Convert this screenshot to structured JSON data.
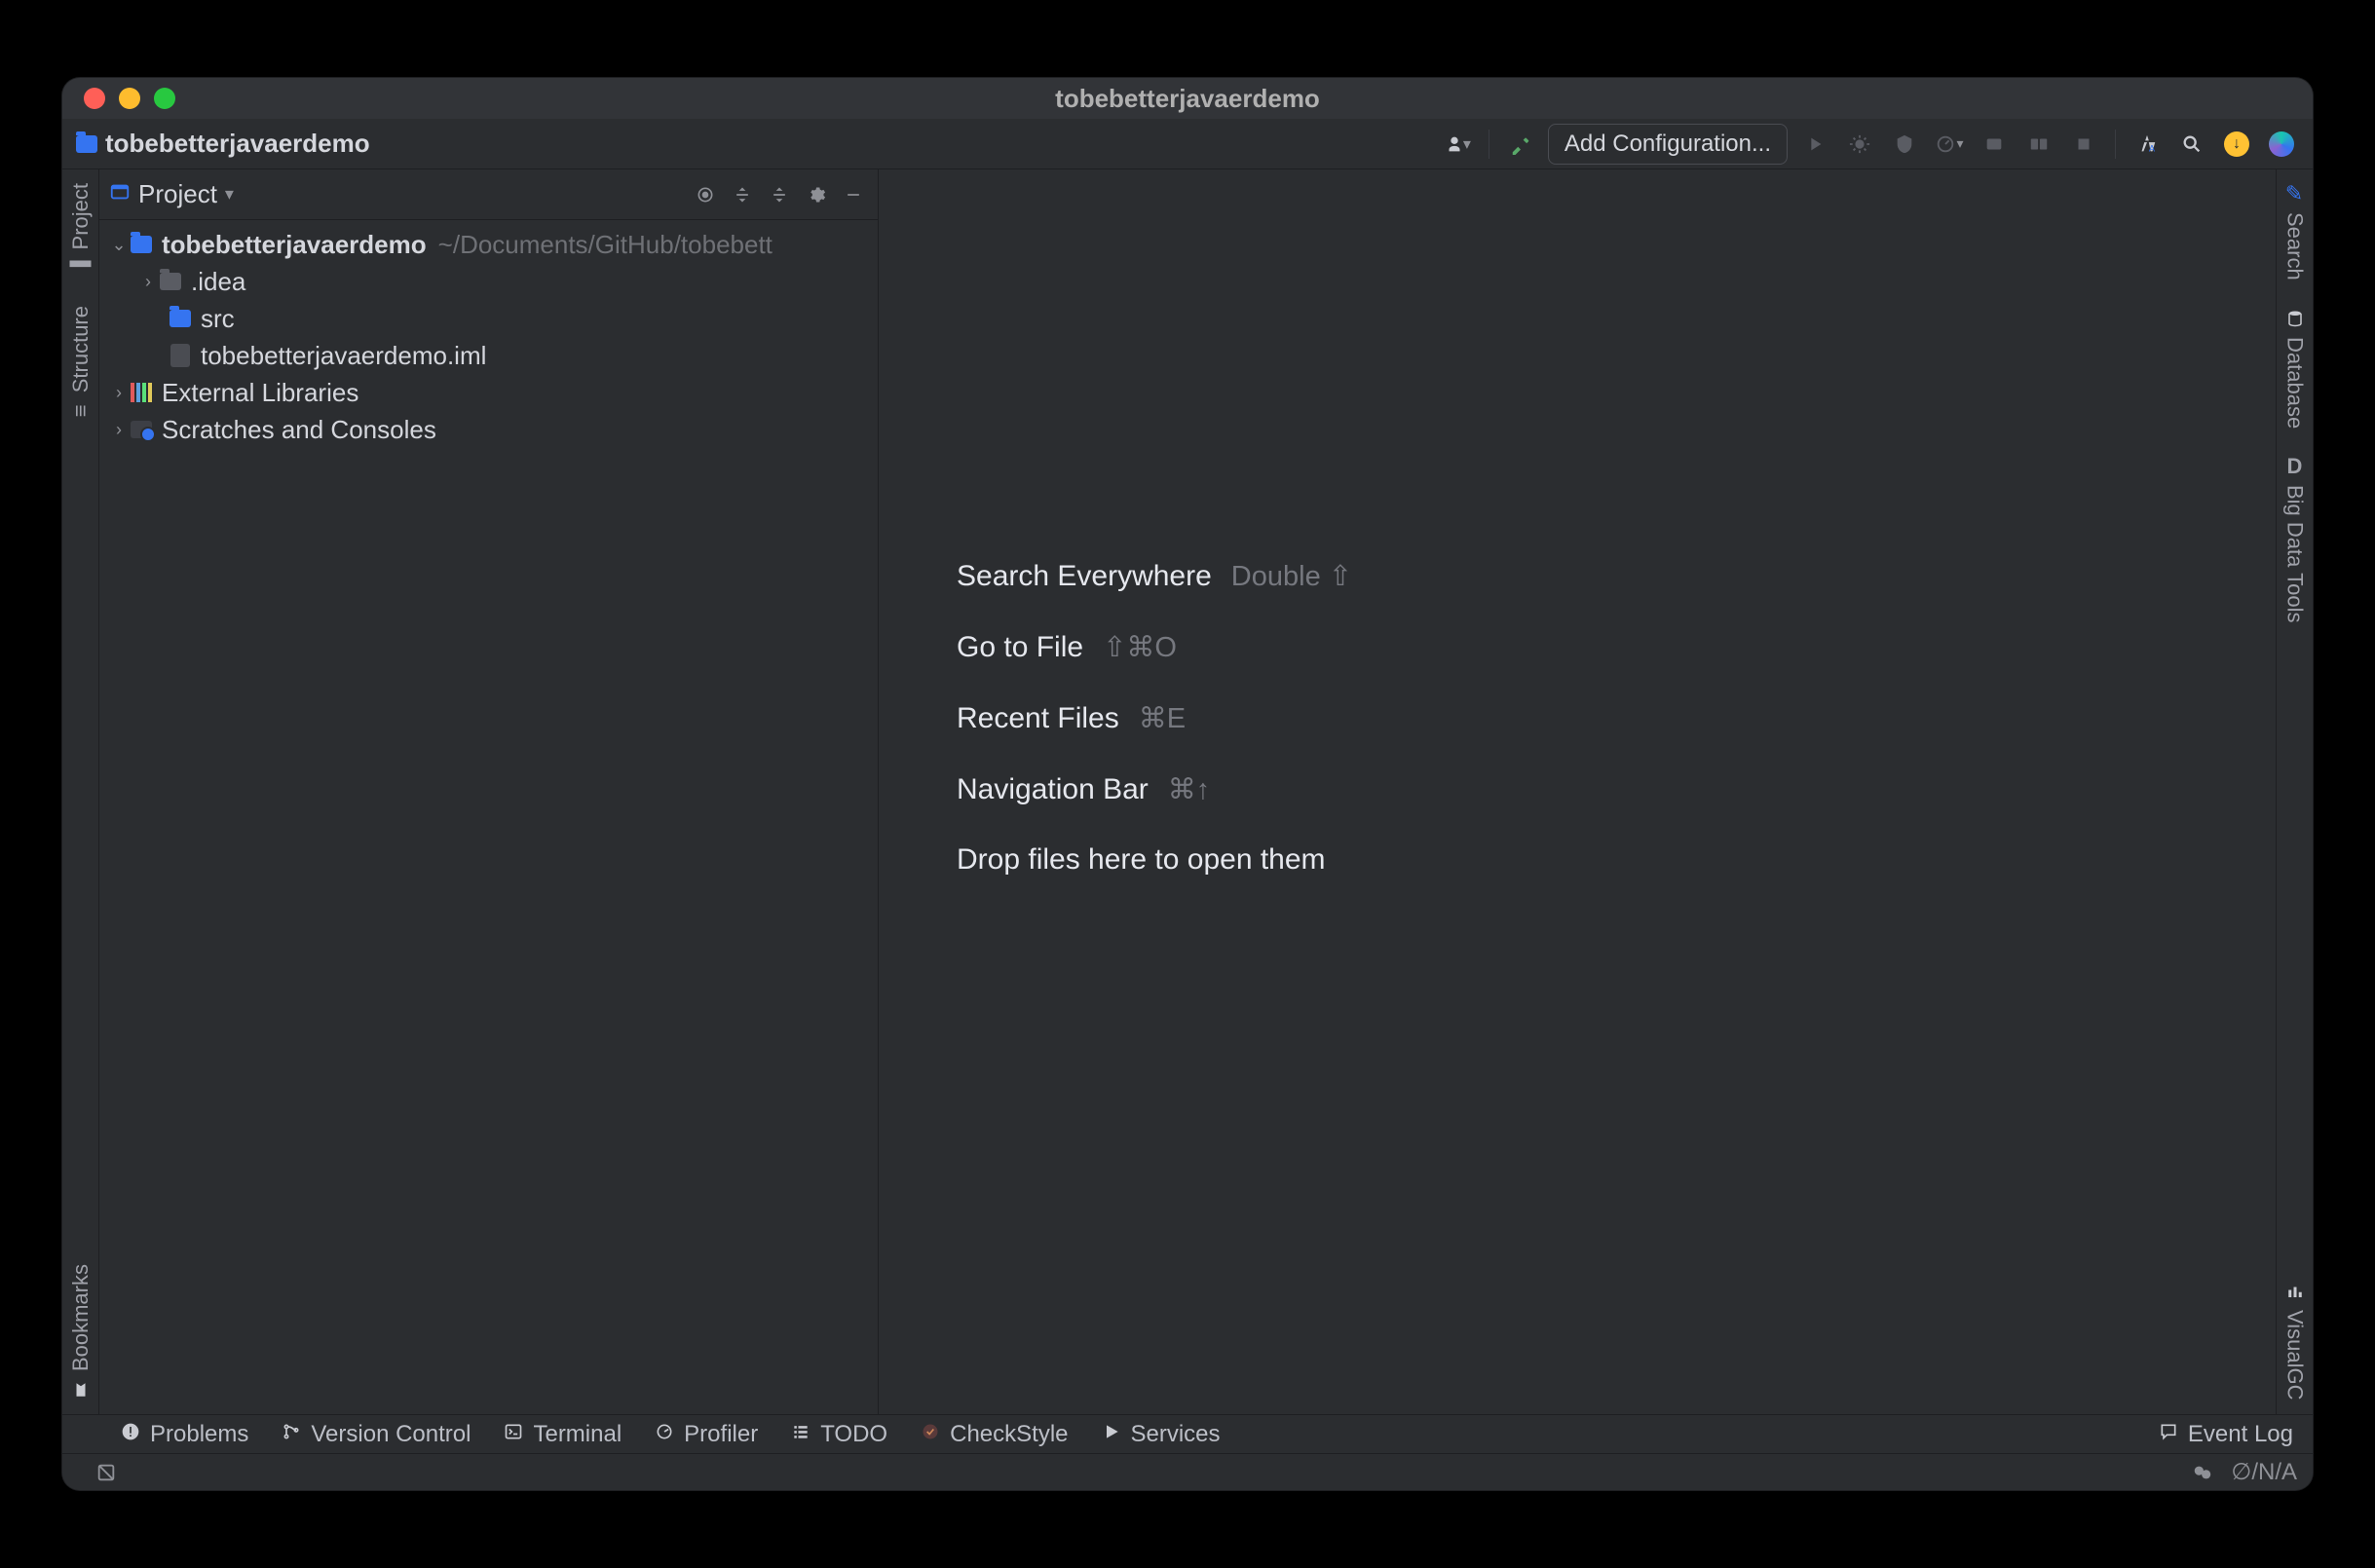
{
  "window_title": "tobebetterjavaerdemo",
  "breadcrumb": {
    "project_name": "tobebetterjavaerdemo"
  },
  "toolbar": {
    "add_config_label": "Add Configuration..."
  },
  "left_rail": {
    "project": "Project",
    "structure": "Structure",
    "bookmarks": "Bookmarks"
  },
  "right_rail": {
    "search": "Search",
    "database": "Database",
    "big_data_tools": "Big Data Tools",
    "big_data_prefix": "D",
    "visualgc": "VisualGC"
  },
  "project_toolwindow": {
    "label": "Project",
    "root": {
      "name": "tobebetterjavaerdemo",
      "path": "~/Documents/GitHub/tobebett"
    },
    "children": [
      {
        "name": ".idea",
        "type": "folder-gray",
        "expandable": true
      },
      {
        "name": "src",
        "type": "folder-blue",
        "expandable": false
      },
      {
        "name": "tobebetterjavaerdemo.iml",
        "type": "file-iml",
        "expandable": false
      }
    ],
    "extra": [
      {
        "name": "External Libraries",
        "type": "libraries",
        "expandable": true
      },
      {
        "name": "Scratches and Consoles",
        "type": "scratches",
        "expandable": true
      }
    ]
  },
  "editor_hints": [
    {
      "action": "Search Everywhere",
      "shortcut": "Double ⇧"
    },
    {
      "action": "Go to File",
      "shortcut": "⇧⌘O"
    },
    {
      "action": "Recent Files",
      "shortcut": "⌘E"
    },
    {
      "action": "Navigation Bar",
      "shortcut": "⌘↑"
    },
    {
      "action": "Drop files here to open them",
      "shortcut": ""
    }
  ],
  "bottom_bar": {
    "problems": "Problems",
    "version_control": "Version Control",
    "terminal": "Terminal",
    "profiler": "Profiler",
    "todo": "TODO",
    "checkstyle": "CheckStyle",
    "services": "Services",
    "event_log": "Event Log"
  },
  "status_bar": {
    "na": "∅/N/A"
  }
}
